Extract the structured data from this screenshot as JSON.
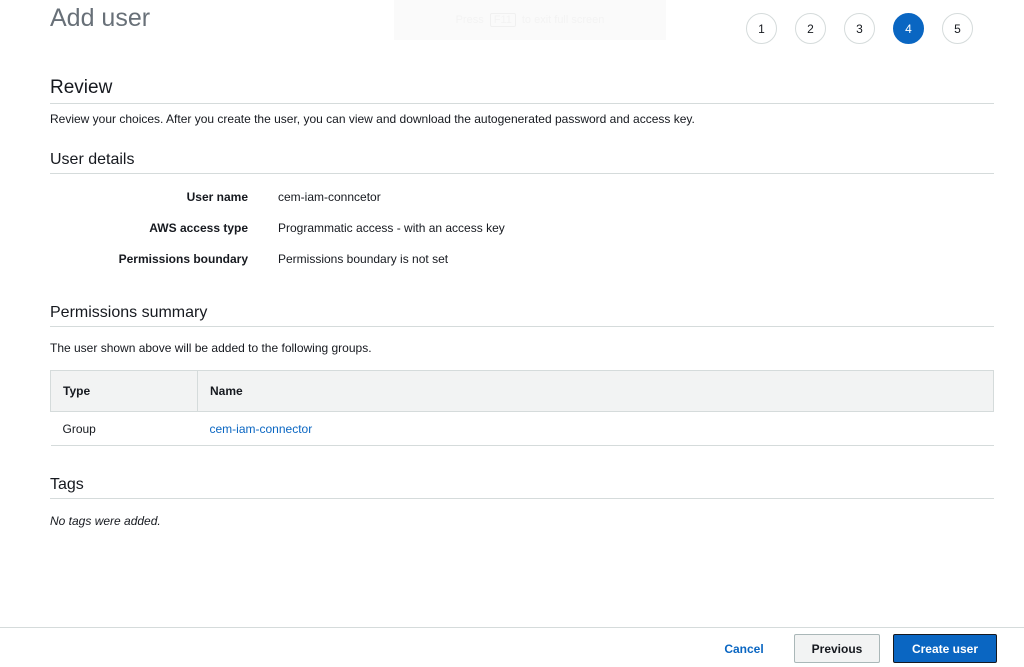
{
  "header": {
    "title": "Add user",
    "fullscreen_hint": {
      "pre": "Press",
      "key": "F11",
      "post": "to exit full screen"
    },
    "steps": [
      "1",
      "2",
      "3",
      "4",
      "5"
    ],
    "active_step": "4"
  },
  "review": {
    "heading": "Review",
    "description": "Review your choices. After you create the user, you can view and download the autogenerated password and access key."
  },
  "user_details": {
    "heading": "User details",
    "rows": [
      {
        "label": "User name",
        "value": "cem-iam-conncetor"
      },
      {
        "label": "AWS access type",
        "value": "Programmatic access - with an access key"
      },
      {
        "label": "Permissions boundary",
        "value": "Permissions boundary is not set"
      }
    ]
  },
  "permissions": {
    "heading": "Permissions summary",
    "description": "The user shown above will be added to the following groups.",
    "columns": [
      "Type",
      "Name"
    ],
    "rows": [
      {
        "type": "Group",
        "name": "cem-iam-connector"
      }
    ]
  },
  "tags": {
    "heading": "Tags",
    "empty_text": "No tags were added."
  },
  "footer": {
    "cancel": "Cancel",
    "previous": "Previous",
    "create": "Create user"
  }
}
